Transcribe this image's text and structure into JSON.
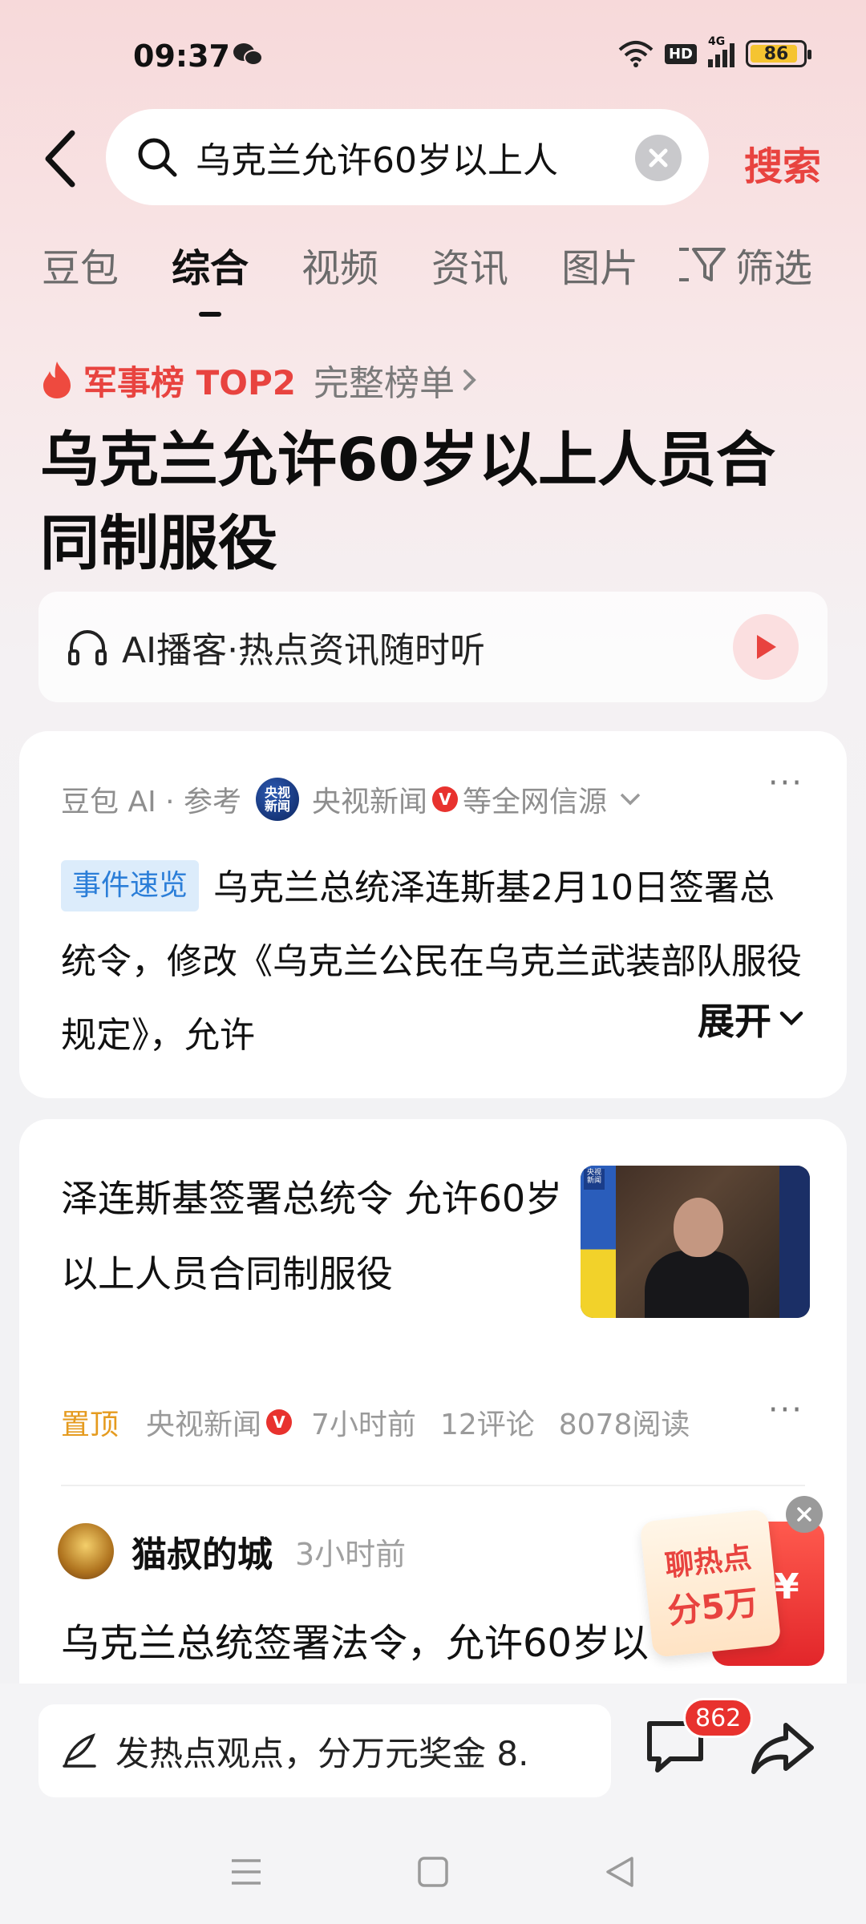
{
  "status_bar": {
    "time": "09:37",
    "network": "4G",
    "hd": "HD",
    "battery": "86",
    "battery_level": 0.86
  },
  "search": {
    "query": "乌克兰允许60岁以上人",
    "button_label": "搜索"
  },
  "tabs": [
    {
      "label": "豆包",
      "active": false
    },
    {
      "label": "综合",
      "active": true
    },
    {
      "label": "视频",
      "active": false
    },
    {
      "label": "资讯",
      "active": false
    },
    {
      "label": "图片",
      "active": false
    }
  ],
  "filter_label": "筛选",
  "hot": {
    "rank_label": "军事榜 TOP2",
    "full_list_label": "完整榜单"
  },
  "headline": "乌克兰允许60岁以上人员合同制服役",
  "podcast": {
    "label": "AI播客·热点资讯随时听"
  },
  "summary_card": {
    "source_prefix": "豆包 AI · 参考",
    "source_name": "央视新闻",
    "source_suffix": "等全网信源",
    "logo_text": "央视新闻",
    "tag": "事件速览",
    "text": "乌克兰总统泽连斯基2月10日签署总统令，修改《乌克兰公民在乌克兰武装部队服役规定》，允许",
    "expand_label": "展开"
  },
  "news_item": {
    "title": "泽连斯基签署总统令 允许60岁以上人员合同制服役",
    "pin_label": "置顶",
    "source": "央视新闻",
    "time": "7小时前",
    "comments": "12评论",
    "reads": "8078阅读",
    "thumb_logo": "央视新闻"
  },
  "post": {
    "author": "猫叔的城",
    "time": "3小时前",
    "text": "乌克兰总统签署法令，允许60岁以"
  },
  "promo": {
    "line1": "聊热点",
    "line2": "分5万",
    "symbol": "¥"
  },
  "bottom": {
    "input_placeholder": "发热点观点，分万元奖金 8.",
    "comment_count": "862"
  },
  "colors": {
    "accent": "#e8433f",
    "tag_bg": "#dcecfb",
    "tag_text": "#2b7ed8",
    "pin": "#e59b1f"
  },
  "icons": [
    "back-icon",
    "search-icon",
    "clear-icon",
    "filter-icon",
    "fire-icon",
    "chevron-right-icon",
    "headphones-icon",
    "play-icon",
    "verified-icon",
    "more-icon",
    "chevron-down-icon",
    "pen-icon",
    "comment-icon",
    "share-icon",
    "menu-icon",
    "home-icon",
    "back-nav-icon",
    "close-icon",
    "wechat-icon",
    "wifi-icon",
    "signal-icon"
  ]
}
